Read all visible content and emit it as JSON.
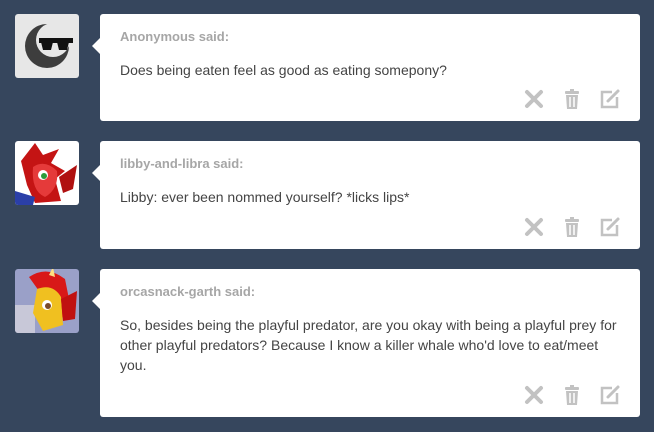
{
  "asks": [
    {
      "asker": "Anonymous said:",
      "question": "Does being eaten feel as good as eating somepony?",
      "avatar_icon": "sunglasses-moon-icon"
    },
    {
      "asker": "libby-and-libra said:",
      "question": "Libby: ever been nommed yourself? *licks lips*",
      "avatar_icon": "red-pony-avatar"
    },
    {
      "asker": "orcasnack-garth said:",
      "question": "So, besides being the playful predator, are you okay with being a playful prey for other playful predators? Because I know a killer whale who'd love to eat/meet you.",
      "avatar_icon": "yellow-pony-avatar"
    }
  ],
  "actions": [
    "close-icon",
    "trash-icon",
    "edit-icon"
  ],
  "colors": {
    "background": "#36465d",
    "card": "#ffffff",
    "asker_text": "#a6a6a6",
    "body_text": "#444444",
    "icon": "#c2c2c2"
  }
}
